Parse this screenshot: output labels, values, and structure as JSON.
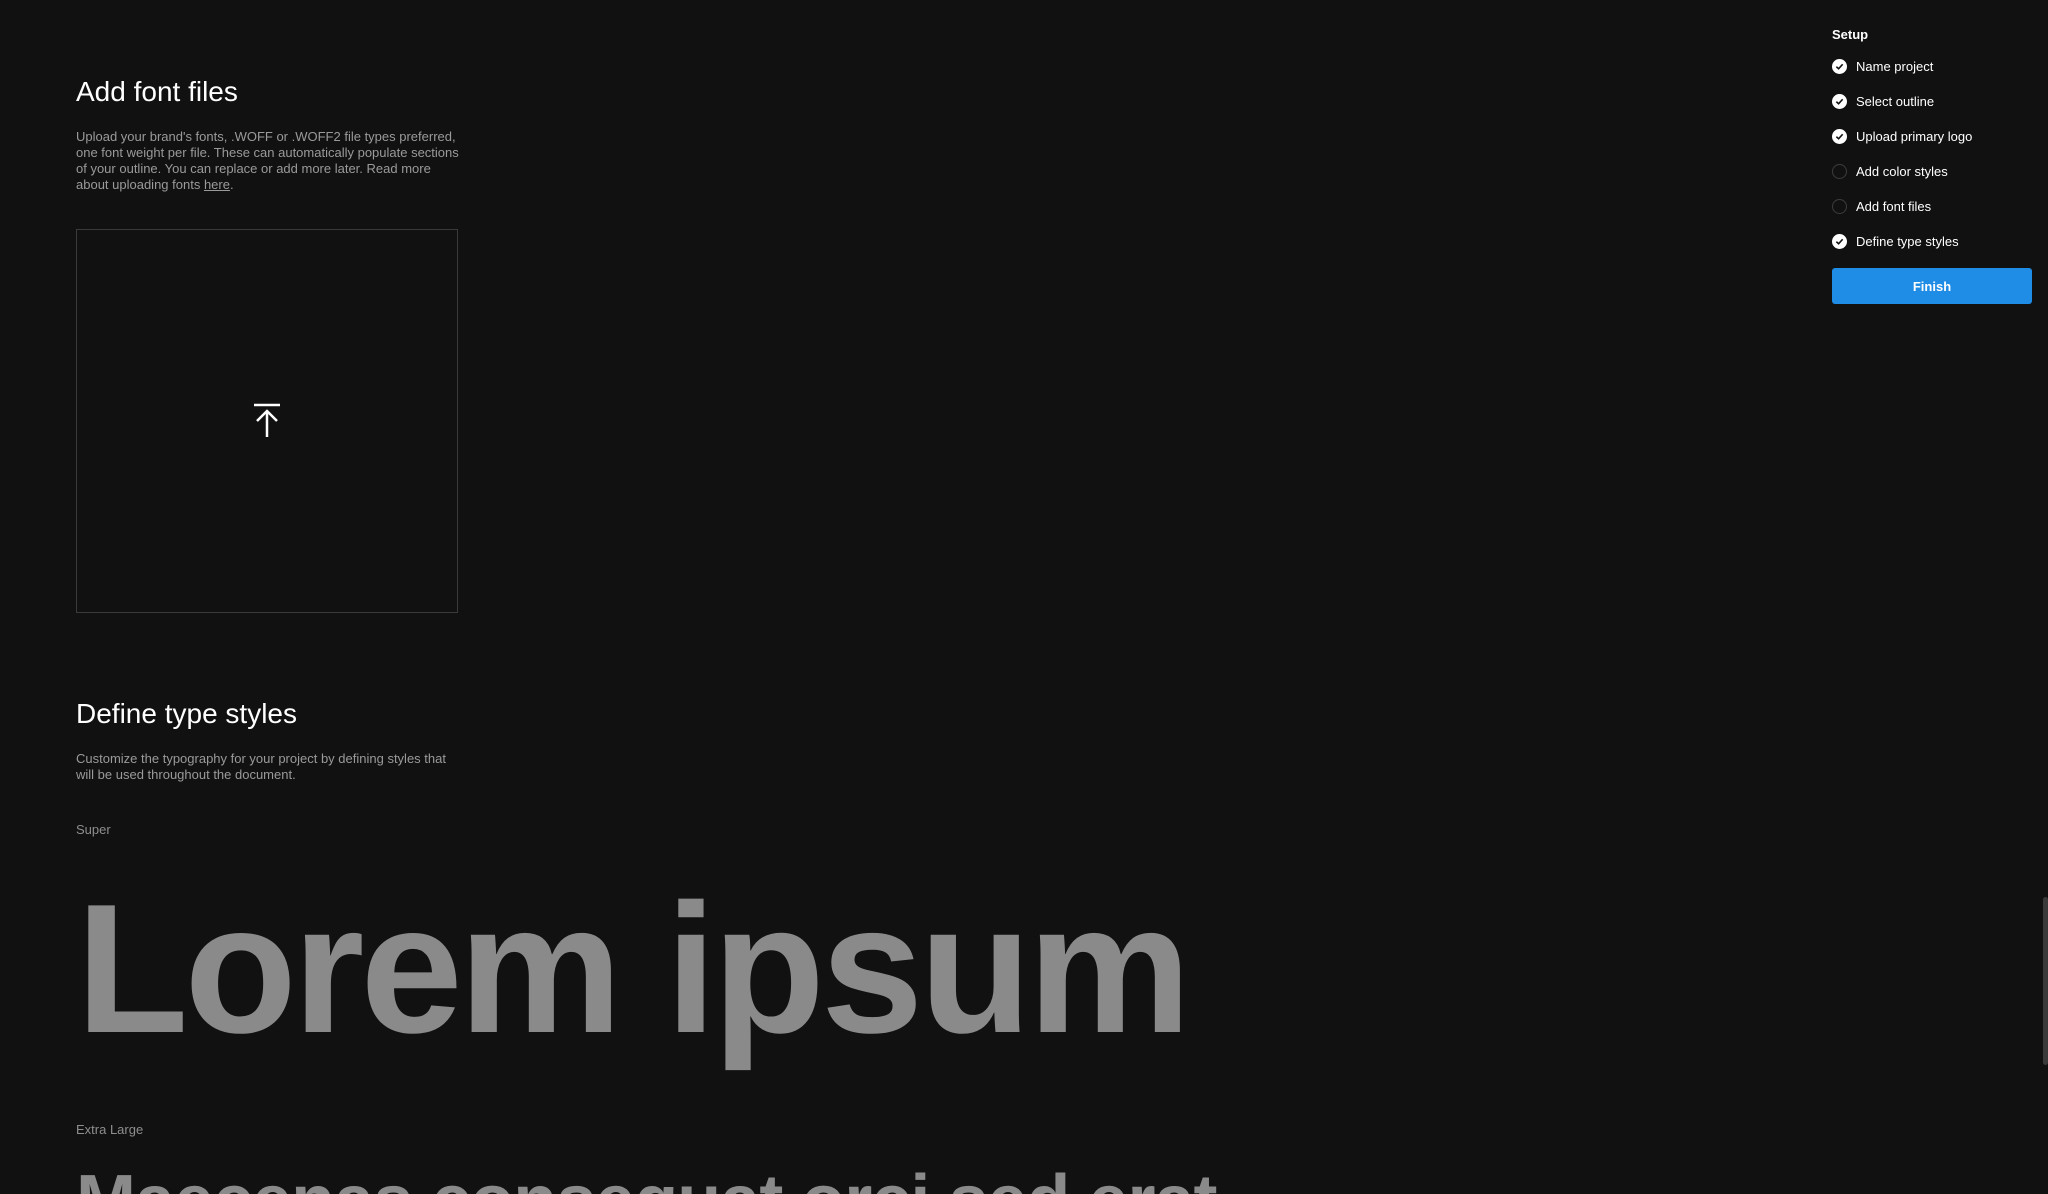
{
  "fonts_section": {
    "title": "Add font files",
    "description": "Upload your brand's fonts, .WOFF or .WOFF2 file types preferred, one font weight per file. These can automatically populate sections of your outline. You can replace or add more later. Read more about uploading fonts ",
    "link_label": "here",
    "period": ".",
    "upload_icon": "upload-arrow-icon"
  },
  "type_section": {
    "title": "Define type styles",
    "description": "Customize the typography for your project by defining styles that will be used throughout the document.",
    "styles": [
      {
        "label": "Super",
        "sample": "Lorem ipsum"
      },
      {
        "label": "Extra Large",
        "sample": "Maecenas consequat orci sed erat"
      }
    ]
  },
  "sidebar": {
    "title": "Setup",
    "steps": [
      {
        "label": "Name project",
        "status": "done"
      },
      {
        "label": "Select outline",
        "status": "done"
      },
      {
        "label": "Upload primary logo",
        "status": "done"
      },
      {
        "label": "Add color styles",
        "status": "todo"
      },
      {
        "label": "Add font files",
        "status": "todo"
      },
      {
        "label": "Define type styles",
        "status": "done"
      }
    ],
    "finish_label": "Finish"
  },
  "colors": {
    "background": "#111111",
    "accent": "#1f8ce6",
    "muted_text": "#9a9a9a",
    "sample_text": "#8a8a8a"
  }
}
